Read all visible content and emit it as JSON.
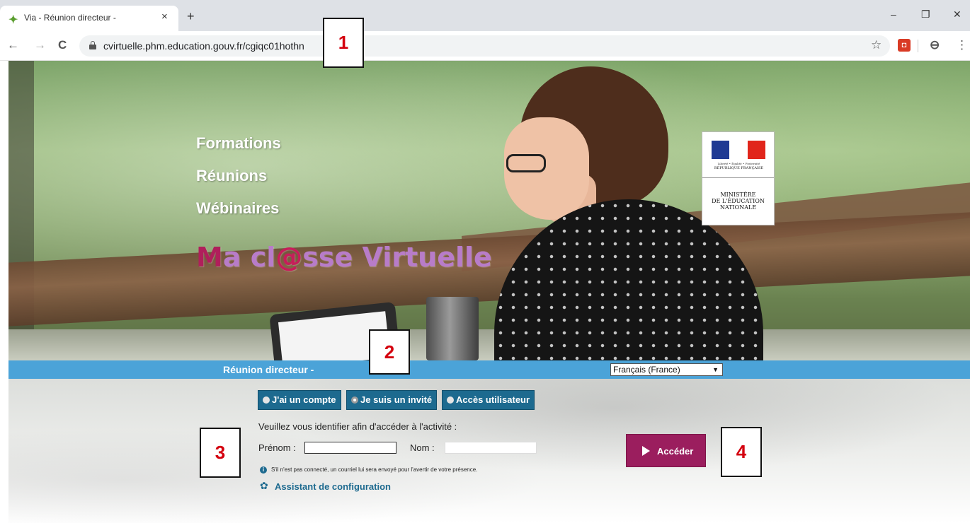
{
  "browser": {
    "tab_title": "Via - Réunion directeur -",
    "tab_close": "×",
    "new_tab": "+",
    "url": "cvirtuelle.phm.education.gouv.fr/cgiqc01hothn",
    "window_controls": {
      "minimize": "–",
      "restore": "❐",
      "close": "✕"
    },
    "nav_icons": {
      "back": "←",
      "forward": "→",
      "reload": "C"
    },
    "toolbar_icons": {
      "bookmark": "☆",
      "profile": "⊖",
      "menu": "⋮"
    }
  },
  "hero": {
    "words": [
      "Formations",
      "Réunions",
      "Wébinaires"
    ],
    "brand": {
      "m": "M",
      "a": "a cl",
      "at": "@",
      "rest": "sse Virtuelle"
    },
    "ministry": {
      "motto": "Liberté • Égalité • Fraternité",
      "republic": "RÉPUBLIQUE FRANÇAISE",
      "line1": "MINISTÈRE",
      "line2": "DE L'ÉDUCATION",
      "line3": "NATIONALE"
    }
  },
  "bar": {
    "meeting_title": "Réunion directeur -",
    "language": "Français (France)",
    "language_arrow": "▼"
  },
  "login": {
    "modes": [
      {
        "label": "J'ai un compte",
        "selected": false
      },
      {
        "label": "Je suis un invité",
        "selected": true
      },
      {
        "label": "Accès utilisateur",
        "selected": false
      }
    ],
    "instruction": "Veuillez vous identifier afin d'accéder à l'activité :",
    "first_name_label": "Prénom :",
    "first_name_value": "",
    "last_name_label": "Nom :",
    "last_name_value": "",
    "info_icon": "i",
    "info_text": "S'il n'est pas connecté, un courriel lui sera envoyé pour l'avertir de votre présence.",
    "wizard_icon": "✿",
    "wizard_label": "Assistant de configuration",
    "submit_label": "Accéder"
  },
  "callouts": [
    "1",
    "2",
    "3",
    "4"
  ],
  "colors": {
    "blue_bar": "#4ba3d8",
    "mode_button": "#1d6a8f",
    "submit_button": "#9b1e5e",
    "callout_text": "#d4000f"
  }
}
